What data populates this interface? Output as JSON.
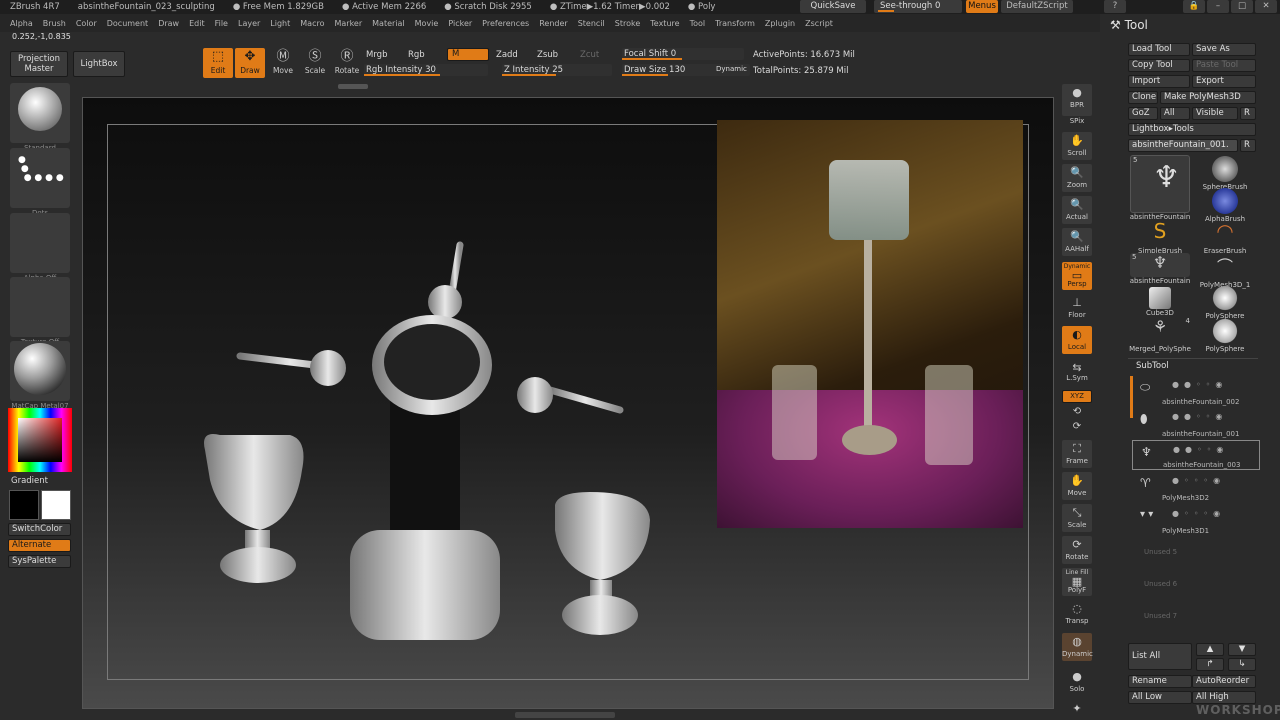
{
  "titlebar": {
    "app": "ZBrush 4R7",
    "document": "absintheFountain_023_sculpting",
    "free_mem": "● Free Mem 1.829GB",
    "active_mem": "● Active Mem 2266",
    "scratch": "● Scratch Disk 2955",
    "ztime": "● ZTime▶1.62 Timer▶0.002",
    "poly": "● Poly",
    "quicksave": "QuickSave",
    "see_through": "See-through  0",
    "menus": "Menus",
    "default_zscript": "DefaultZScript"
  },
  "menubar": {
    "items": [
      "Alpha",
      "Brush",
      "Color",
      "Document",
      "Draw",
      "Edit",
      "File",
      "Layer",
      "Light",
      "Macro",
      "Marker",
      "Material",
      "Movie",
      "Picker",
      "Preferences",
      "Render",
      "Stencil",
      "Stroke",
      "Texture",
      "Tool",
      "Transform",
      "Zplugin",
      "Zscript"
    ]
  },
  "coords": "0.252,-1,0.835",
  "shelf": {
    "projection_master": "Projection Master",
    "lightbox": "LightBox",
    "edit": "Edit",
    "draw": "Draw",
    "move": "Move",
    "scale": "Scale",
    "rotate": "Rotate",
    "mrgb": "Mrgb",
    "rgb": "Rgb",
    "m": "M",
    "zadd": "Zadd",
    "zsub": "Zsub",
    "zcut": "Zcut",
    "rgb_intensity": "Rgb Intensity 30",
    "z_intensity": "Z Intensity 25",
    "focal_shift": "Focal Shift 0",
    "draw_size": "Draw Size 130",
    "dynamic": "Dynamic",
    "active_points": "ActivePoints: 16.673 Mil",
    "total_points": "TotalPoints: 25.879 Mil"
  },
  "left": {
    "standard": "Standard",
    "dots": "Dots",
    "alpha_off": "Alpha Off",
    "texture_off": "Texture Off",
    "matcap": "MatCap Metal07",
    "gradient": "Gradient",
    "switchcolor": "SwitchColor",
    "alternate": "Alternate",
    "syspalette": "SysPalette"
  },
  "rightbar": {
    "bpr": "BPR",
    "spix": "SPix",
    "scroll": "Scroll",
    "zoom": "Zoom",
    "actual": "Actual",
    "aahalf": "AAHalf",
    "dynamic": "Dynamic",
    "persp": "Persp",
    "floor": "Floor",
    "local": "Local",
    "lsym": "L.Sym",
    "xyz": "XYZ",
    "frame": "Frame",
    "move": "Move",
    "scale": "Scale",
    "rotate": "Rotate",
    "line_fill": "Line Fill",
    "polyf": "PolyF",
    "transp": "Transp",
    "dynamic2": "Dynamic",
    "solo": "Solo",
    "xpose": "Xpose"
  },
  "tool": {
    "title": "Tool",
    "load_tool": "Load Tool",
    "save_as": "Save As",
    "copy_tool": "Copy Tool",
    "paste_tool": "Paste Tool",
    "import": "Import",
    "export": "Export",
    "clone": "Clone",
    "make_polymesh": "Make PolyMesh3D",
    "goz": "GoZ",
    "all": "All",
    "visible": "Visible",
    "r": "R",
    "lightbox_tools": "Lightbox▸Tools",
    "current_tool": "absintheFountain_001.",
    "grid": [
      {
        "name": "absintheFountain",
        "count": "5"
      },
      {
        "name": "SphereBrush",
        "count": ""
      },
      {
        "name": "AlphaBrush",
        "count": ""
      },
      {
        "name": "SimpleBrush",
        "count": ""
      },
      {
        "name": "EraserBrush",
        "count": ""
      },
      {
        "name": "absintheFountain",
        "count": "5"
      },
      {
        "name": "PolyMesh3D_1",
        "count": ""
      },
      {
        "name": "Cube3D",
        "count": ""
      },
      {
        "name": "PolySphere",
        "count": ""
      },
      {
        "name": "Merged_PolySphe",
        "count": "4"
      },
      {
        "name": "PolySphere",
        "count": ""
      }
    ],
    "subtool_title": "SubTool",
    "subtools": [
      "absintheFountain_002",
      "absintheFountain_001",
      "absintheFountain_003",
      "PolyMesh3D2",
      "PolyMesh3D1"
    ],
    "unused": [
      "Unused 5",
      "Unused 6",
      "Unused 7"
    ],
    "list_all": "List  All",
    "rename": "Rename",
    "autoreorder": "AutoReorder",
    "all_low": "All Low",
    "all_high": "All High"
  },
  "watermark": "WORKSHOP"
}
